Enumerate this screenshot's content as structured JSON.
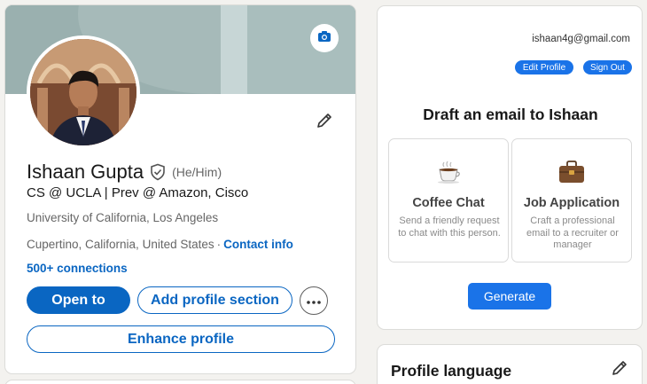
{
  "profile": {
    "name": "Ishaan Gupta",
    "pronouns": "(He/Him)",
    "headline": "CS @ UCLA | Prev @ Amazon, Cisco",
    "education": "University of California, Los Angeles",
    "location": "Cupertino, California, United States",
    "separator": "·",
    "contact_info": "Contact info",
    "connections": "500+ connections",
    "buttons": {
      "open_to": "Open to",
      "add_section": "Add profile section",
      "enhance": "Enhance profile"
    }
  },
  "extension": {
    "email": "ishaan4g@gmail.com",
    "edit_profile": "Edit Profile",
    "sign_out": "Sign Out",
    "title": "Draft an email to Ishaan",
    "options": [
      {
        "title": "Coffee Chat",
        "description": "Send a friendly request to chat with this person.",
        "icon": "coffee-icon"
      },
      {
        "title": "Job Application",
        "description": "Craft a professional email to a recruiter or manager",
        "icon": "briefcase-icon"
      }
    ],
    "generate": "Generate"
  },
  "language_section": {
    "title": "Profile language"
  },
  "colors": {
    "linkedin_blue": "#0a66c2",
    "extension_blue": "#1a73e8",
    "page_bg": "#f3f2ef",
    "banner": "#93a9a8"
  }
}
